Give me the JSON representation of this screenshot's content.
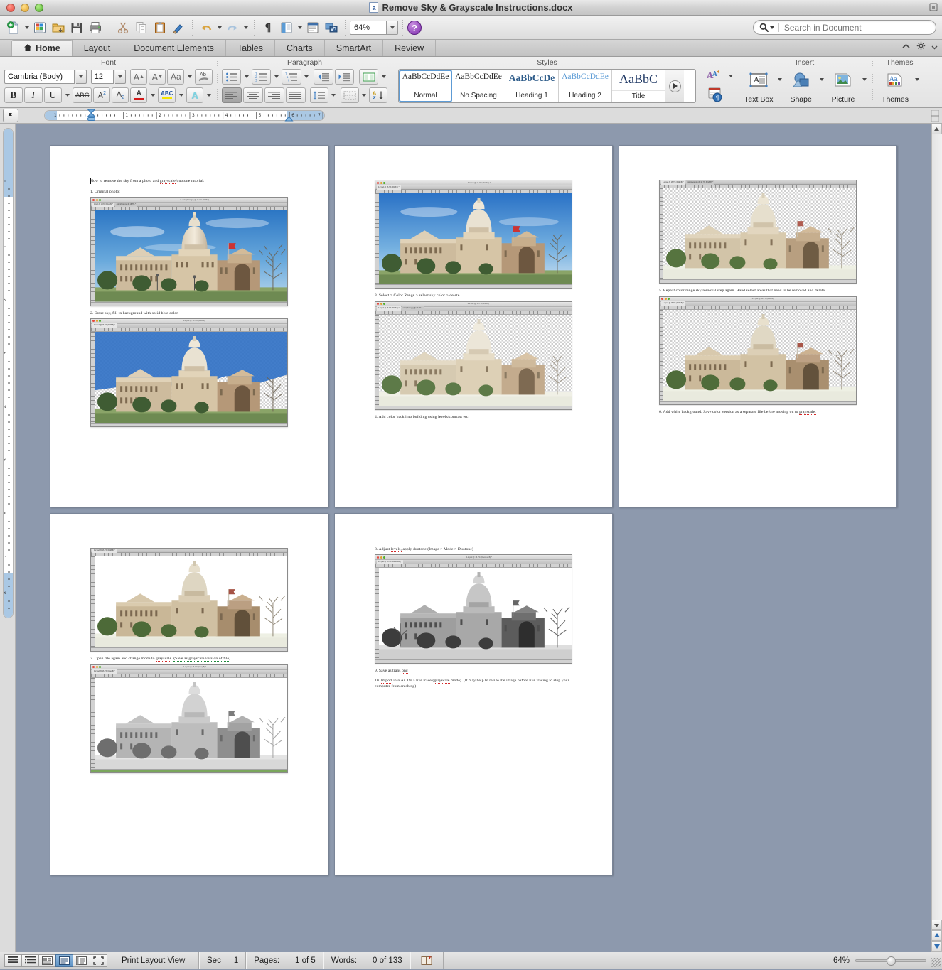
{
  "window": {
    "title": "Remove Sky & Grayscale Instructions.docx",
    "doc_icon": "a"
  },
  "toolbar": {
    "zoom_value": "64%",
    "buttons": [
      {
        "name": "new-document",
        "label": "New"
      },
      {
        "name": "open-gallery",
        "label": "Gallery"
      },
      {
        "name": "open-file",
        "label": "Open"
      },
      {
        "name": "save",
        "label": "Save"
      },
      {
        "name": "print",
        "label": "Print"
      },
      {
        "name": "cut",
        "label": "Cut"
      },
      {
        "name": "copy",
        "label": "Copy"
      },
      {
        "name": "paste",
        "label": "Paste"
      },
      {
        "name": "format-painter",
        "label": "Format"
      },
      {
        "name": "undo",
        "label": "Undo"
      },
      {
        "name": "redo",
        "label": "Redo"
      },
      {
        "name": "show-formatting",
        "label": "Show"
      },
      {
        "name": "sidebar",
        "label": "Sidebar"
      },
      {
        "name": "notebook",
        "label": "Notebook"
      },
      {
        "name": "media-browser",
        "label": "Media"
      }
    ],
    "help_label": "?"
  },
  "search": {
    "placeholder": "Search in Document",
    "value": ""
  },
  "tabs": [
    {
      "label": "Home",
      "active": true
    },
    {
      "label": "Layout",
      "active": false
    },
    {
      "label": "Document Elements",
      "active": false
    },
    {
      "label": "Tables",
      "active": false
    },
    {
      "label": "Charts",
      "active": false
    },
    {
      "label": "SmartArt",
      "active": false
    },
    {
      "label": "Review",
      "active": false
    }
  ],
  "ribbon": {
    "groups": [
      {
        "title": "Font"
      },
      {
        "title": "Paragraph"
      },
      {
        "title": "Styles"
      },
      {
        "title": "Insert"
      },
      {
        "title": "Themes"
      }
    ],
    "font": {
      "name": "Cambria (Body)",
      "size": "12",
      "grow_label": "A",
      "shrink_label": "A",
      "change_case_label": "Aa",
      "clear_formatting_label": "Ab",
      "bold_label": "B",
      "italic_label": "I",
      "underline_label": "U",
      "strikethrough_label": "ABC",
      "superscript_label": "A2",
      "subscript_label": "A2",
      "font_color_label": "A",
      "highlight_label": "ABC",
      "text_effects_label": "A"
    },
    "styles_gallery": [
      {
        "sample": "AaBbCcDdEе",
        "label": "Normal",
        "selected": true,
        "weight": "400",
        "color": "#1f1f1f",
        "size": "11.5px"
      },
      {
        "sample": "AaBbCcDdEе",
        "label": "No Spacing",
        "selected": false,
        "weight": "400",
        "color": "#1f1f1f",
        "size": "11.5px"
      },
      {
        "sample": "AaBbCcDе",
        "label": "Heading 1",
        "selected": false,
        "weight": "700",
        "color": "#2e5c8a",
        "size": "13px"
      },
      {
        "sample": "AaBbCcDdEе",
        "label": "Heading 2",
        "selected": false,
        "weight": "400",
        "color": "#5b9bd5",
        "size": "11.5px"
      },
      {
        "sample": "AaBbC",
        "label": "Title",
        "selected": false,
        "weight": "400",
        "color": "#1f3864",
        "size": "17px"
      }
    ],
    "insert": [
      {
        "name": "text-box",
        "label": "Text Box"
      },
      {
        "name": "shape",
        "label": "Shape"
      },
      {
        "name": "picture",
        "label": "Picture"
      }
    ],
    "themes": [
      {
        "name": "themes",
        "label": "Themes"
      }
    ]
  },
  "ruler": {
    "horizontal_labels": [
      "1",
      "1",
      "2",
      "3",
      "4",
      "5",
      "6",
      "7"
    ],
    "vertical_labels": [
      "1",
      "1",
      "2",
      "3",
      "4",
      "5",
      "6",
      "7",
      "8"
    ],
    "tab_selector": "L"
  },
  "document": {
    "pages": [
      {
        "number": 1,
        "blocks": [
          {
            "type": "text",
            "runs": [
              {
                "t": "How to remove the sky from a photo and ",
                "mark": "none"
              },
              {
                "t": "grayscale",
                "mark": "spelling"
              },
              {
                "t": "/duotone tutorial:",
                "mark": "none"
              }
            ]
          },
          {
            "type": "text",
            "gap": true,
            "runs": [
              {
                "t": "1. Original photo:",
                "mark": "none"
              }
            ]
          },
          {
            "type": "screenshot",
            "variant": "color-sky",
            "title": "tx-colorphoto.jpg @ 16.7% (RGB/8)",
            "tabs": [
              "1.psd @ 100% (RGB/8) *",
              "colorphoto.jpg @ 16.7% (RGB/8) *"
            ]
          },
          {
            "type": "text",
            "gap": true,
            "runs": [
              {
                "t": "2. Erase sky, fill in background with solid blue color.",
                "mark": "none"
              }
            ]
          },
          {
            "type": "screenshot",
            "variant": "blue-fill",
            "title": "4-2.psd @ 16.7% (RGB/8) *",
            "tabs": [
              "4-2.psd @ 16.7% (RGB/8) *"
            ]
          }
        ]
      },
      {
        "number": 2,
        "blocks": [
          {
            "type": "screenshot",
            "variant": "color-sky",
            "title": "4-2.psd @ 16.7% (RGB/8) *",
            "tabs": [
              "4-2.psd @ 16.7% (RGB/8) *"
            ]
          },
          {
            "type": "text",
            "gap": true,
            "runs": [
              {
                "t": "3. Select > Color Range ",
                "mark": "none"
              },
              {
                "t": "> select",
                "mark": "grammar"
              },
              {
                "t": " sky color > delete.",
                "mark": "none"
              }
            ]
          },
          {
            "type": "screenshot",
            "variant": "transparent",
            "title": "4-2.psd @ 16.7% (RGB/8) *",
            "tabs": [
              "4-2.psd @ 16.7% (RGB/8) *",
              "colorphoto.jpg @ 16.7% *"
            ]
          },
          {
            "type": "text",
            "gap": true,
            "runs": [
              {
                "t": "4. Add color back into building using levels/contrast etc.",
                "mark": "none"
              }
            ]
          }
        ]
      },
      {
        "number": 3,
        "blocks": [
          {
            "type": "screenshot",
            "variant": "transparent",
            "title": "4-2.psd @ 16.7% (RGB/8) *",
            "tabs": [
              "4-2.psd @ 16.7% (RGB/8) *",
              "colorphoto.jpg @ 16.7% (RGB/8) *"
            ]
          },
          {
            "type": "text",
            "gap": true,
            "runs": [
              {
                "t": "5. Repeat color range sky removal step again. Hand select areas that need to be removed and delete.",
                "mark": "none"
              }
            ]
          },
          {
            "type": "screenshot",
            "variant": "transparent",
            "title": "4-2.psd @ 16.7% (RGB/8) *",
            "tabs": [
              "4-2.psd @ 16.7% (RGB/8) *"
            ]
          },
          {
            "type": "text",
            "gap": true,
            "runs": [
              {
                "t": "6. Add white background. Save color version as a separate file before moving on to ",
                "mark": "none"
              },
              {
                "t": "grayscale.",
                "mark": "spelling"
              }
            ]
          }
        ]
      },
      {
        "number": 4,
        "blocks": [
          {
            "type": "screenshot",
            "variant": "white-bg",
            "title": "4-2.psd @ 16.7% (RGB/8) *",
            "tabs": [
              "4-2.psd @ 16.7% (RGB/8) *"
            ]
          },
          {
            "type": "text",
            "gap": true,
            "runs": [
              {
                "t": "7. Open file again and change mode to ",
                "mark": "none"
              },
              {
                "t": "grayscale",
                "mark": "spelling"
              },
              {
                "t": ". ",
                "mark": "none"
              },
              {
                "t": "(Save as grayscale version of file)",
                "mark": "grammar"
              }
            ]
          },
          {
            "type": "screenshot",
            "variant": "gray",
            "title": "4-2.psd @ 16.7% (Gray/8) *",
            "tabs": [
              "4-2.psd @ 16.7% (Gray/8) *"
            ]
          }
        ]
      },
      {
        "number": 5,
        "blocks": [
          {
            "type": "text",
            "runs": [
              {
                "t": "8. Adjust ",
                "mark": "none"
              },
              {
                "t": "levels,",
                "mark": "spelling"
              },
              {
                "t": " apply duotone (Image > Mode > Duotone)",
                "mark": "none"
              }
            ]
          },
          {
            "type": "screenshot",
            "variant": "duotone",
            "title": "4-2.psd @ 16.7% (Duotone/8) *",
            "tabs": [
              "4-2.psd @ 16.7% (Duotone/8) *"
            ]
          },
          {
            "type": "text",
            "gap": true,
            "runs": [
              {
                "t": "9. Save as trans ",
                "mark": "none"
              },
              {
                "t": "png",
                "mark": "spelling"
              }
            ]
          },
          {
            "type": "text",
            "gap": true,
            "runs": [
              {
                "t": "10. ",
                "mark": "none"
              },
              {
                "t": "Import",
                "mark": "spelling"
              },
              {
                "t": " into Ai. Do a live trace (",
                "mark": "none"
              },
              {
                "t": "grayscale",
                "mark": "spelling"
              },
              {
                "t": " mode). (It may help to resize the image before live tracing to stop your computer from crashing)",
                "mark": "none"
              }
            ]
          }
        ]
      }
    ]
  },
  "status": {
    "view_label": "Print Layout View",
    "sec_label": "Sec",
    "sec_value": "1",
    "pages_label": "Pages:",
    "pages_value": "1 of 5",
    "words_label": "Words:",
    "words_value": "0 of 133",
    "zoom_value": "64%",
    "view_buttons": [
      {
        "name": "draft-view",
        "on": false
      },
      {
        "name": "outline-view",
        "on": false
      },
      {
        "name": "publishing-layout-view",
        "on": false
      },
      {
        "name": "print-layout-view",
        "on": true
      },
      {
        "name": "notebook-layout-view",
        "on": false
      },
      {
        "name": "focus-view",
        "on": false
      }
    ]
  },
  "colors": {
    "accent": "#5d9bd5",
    "spelling_error": "#d42a2a",
    "grammar_error": "#1f8a3c",
    "workspace_bg": "#8d99ad",
    "page_bg": "#ffffff"
  }
}
